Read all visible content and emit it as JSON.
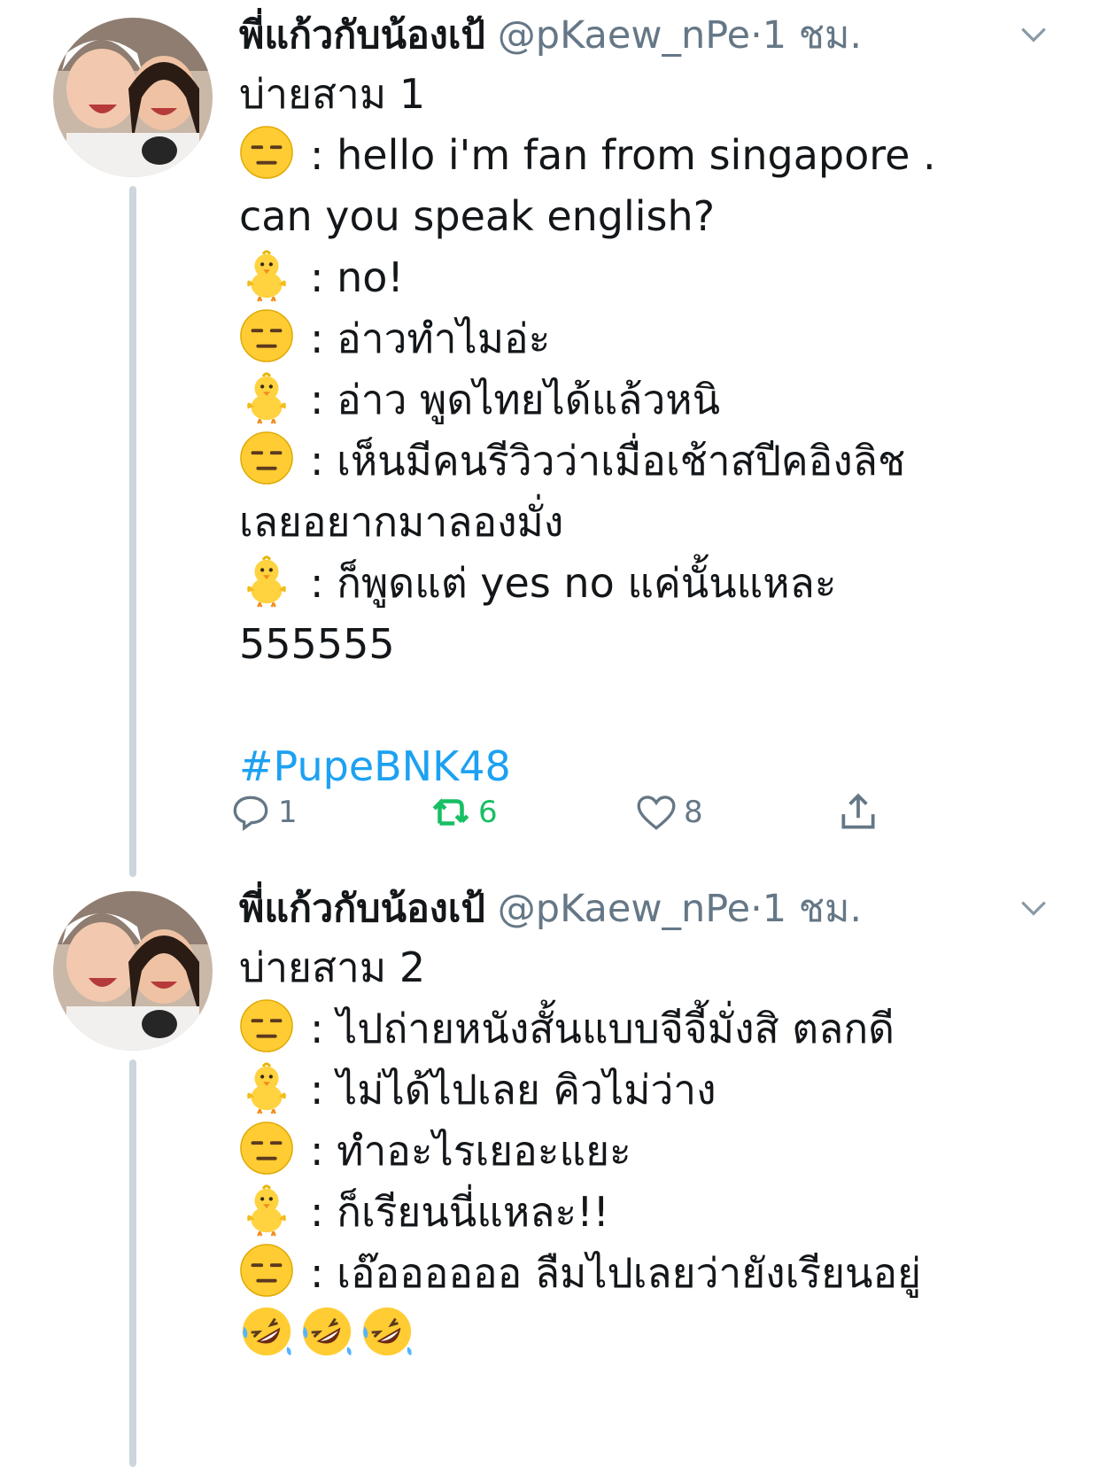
{
  "tweets": [
    {
      "name": "พี่แก้วกับน้องเป้",
      "handle": "@pKaew_nPe",
      "separator": "·",
      "time": "1 ชม.",
      "lines": [
        {
          "emoji": "",
          "text": "บ่ายสาม 1"
        },
        {
          "emoji": "expressionless-face",
          "text": ": hello i'm fan from singapore ."
        },
        {
          "emoji": "",
          "text": "can you speak english?"
        },
        {
          "emoji": "baby-chick",
          "text": ": no!"
        },
        {
          "emoji": "expressionless-face",
          "text": ": อ่าวทำไมอ่ะ"
        },
        {
          "emoji": "baby-chick",
          "text": ": อ่าว พูดไทยได้แล้วหนิ"
        },
        {
          "emoji": "expressionless-face",
          "text": ": เห็นมีคนรีวิวว่าเมื่อเช้าสปีคอิงลิช"
        },
        {
          "emoji": "",
          "text": "เลยอยากมาลองมั่ง"
        },
        {
          "emoji": "baby-chick",
          "text": ": ก็พูดแต่ yes no แค่นั้นแหละ"
        },
        {
          "emoji": "",
          "text": "555555"
        },
        {
          "emoji": "",
          "text": ""
        },
        {
          "emoji": "",
          "text": "#PupeBNK48",
          "hashtag": true
        }
      ],
      "actions": {
        "reply_count": "1",
        "retweet_count": "6",
        "like_count": "8"
      }
    },
    {
      "name": "พี่แก้วกับน้องเป้",
      "handle": "@pKaew_nPe",
      "separator": "·",
      "time": "1 ชม.",
      "lines": [
        {
          "emoji": "",
          "text": "บ่ายสาม 2"
        },
        {
          "emoji": "expressionless-face",
          "text": ": ไปถ่ายหนังสั้นแบบจีจี้มั่งสิ ตลกดี"
        },
        {
          "emoji": "baby-chick",
          "text": ": ไม่ได้ไปเลย คิวไม่ว่าง"
        },
        {
          "emoji": "expressionless-face",
          "text": ": ทำอะไรเยอะแยะ"
        },
        {
          "emoji": "baby-chick",
          "text": ": ก็เรียนนี่แหละ!!"
        },
        {
          "emoji": "expressionless-face",
          "text": ": เอ๊ออออออ ลืมไปเลยว่ายังเรียนอยู่"
        },
        {
          "emoji": "rofl-face-x3",
          "text": ""
        }
      ]
    }
  ],
  "colors": {
    "text": "#14171a",
    "muted": "#657786",
    "link": "#1da1f2",
    "retweet": "#17bf63",
    "thread_line": "#cdd6dd"
  }
}
